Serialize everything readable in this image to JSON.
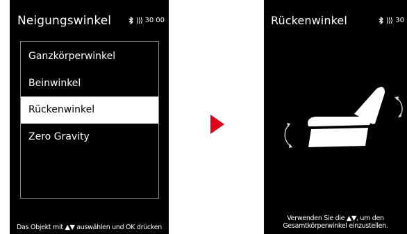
{
  "left_screen": {
    "title": "Neigungswinkel",
    "status": {
      "signal_text": "30",
      "timer_text": "00"
    },
    "menu": [
      {
        "label": "Ganzkörperwinkel",
        "selected": false
      },
      {
        "label": "Beinwinkel",
        "selected": false
      },
      {
        "label": "Rückenwinkel",
        "selected": true
      },
      {
        "label": "Zero Gravity",
        "selected": false
      }
    ],
    "footer": "Das Objekt mit ▲▼ auswählen und OK drücken"
  },
  "right_screen": {
    "title": "Rückenwinkel",
    "status": {
      "signal_text": "30"
    },
    "footer_line1": "Verwenden Sie die ▲▼, um den",
    "footer_line2": "Gesamtkörperwinkel einzustellen."
  },
  "colors": {
    "screen_bg": "#000000",
    "text": "#ffffff",
    "accent_arrow": "#e2001a",
    "selected_bg": "#ffffff"
  },
  "icons": [
    "bluetooth-icon",
    "signal-waves-icon",
    "chair-recline-icon",
    "rotate-arrow-icon"
  ]
}
